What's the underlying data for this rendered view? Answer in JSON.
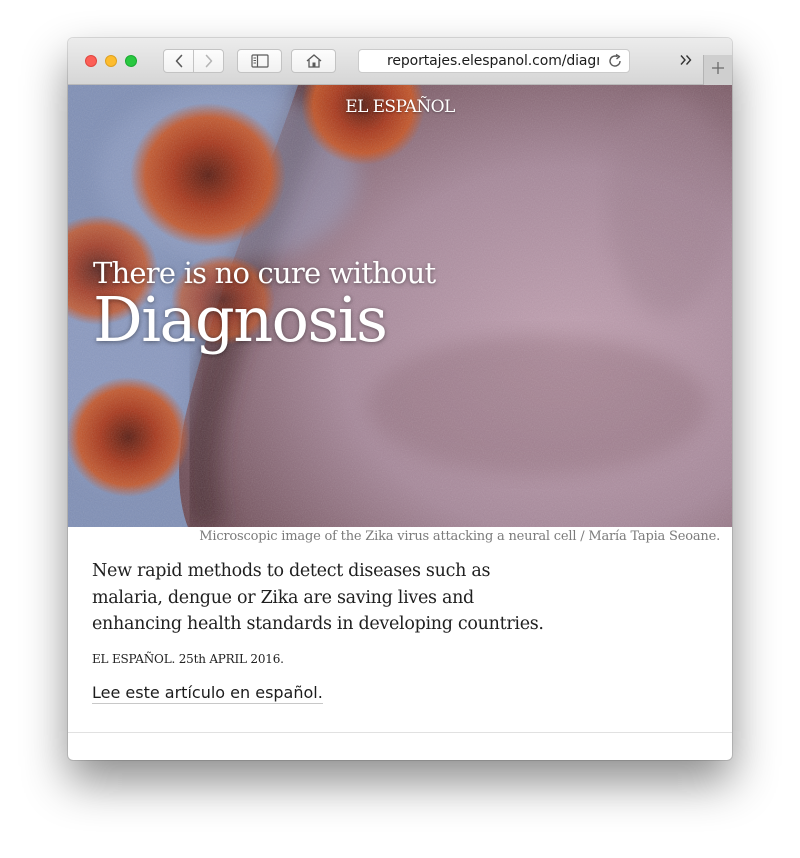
{
  "browser": {
    "url": "reportajes.elespanol.com/diagnosis",
    "icons": {
      "back": "chevron-left-icon",
      "forward": "chevron-right-icon",
      "sidebar": "sidebar-icon",
      "home": "home-icon",
      "reload": "reload-icon",
      "overflow": "double-chevron-right-icon",
      "new_tab": "plus-icon"
    }
  },
  "page": {
    "logo": "EL ESPAÑOL",
    "hero_subtitle": "There is no cure without",
    "hero_title": "Diagnosis",
    "caption": "Microscopic image of the Zika virus attacking a neural cell / María Tapia Seoane.",
    "lead": "New rapid methods to detect diseases such as malaria, dengue or Zika are saving lives and enhancing health standards in developing countries.",
    "byline": "EL ESPAÑOL. 25th APRIL 2016.",
    "spanish_link": "Lee este artículo en español",
    "spanish_link_suffix": "."
  },
  "colors": {
    "hero_base": "#8f6e7e",
    "virus_orange": "#c1441c",
    "cell_pink": "#b896a8"
  }
}
